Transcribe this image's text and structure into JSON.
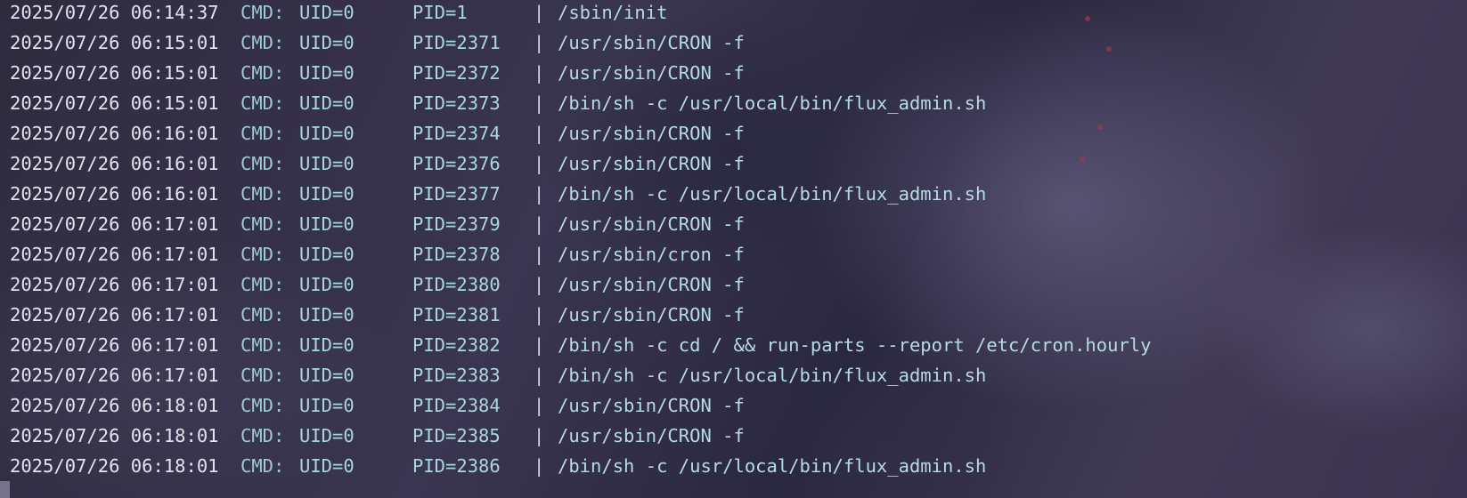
{
  "terminal": {
    "lines": [
      {
        "timestamp": "2025/07/26 06:14:37",
        "tag": "CMD:",
        "uid": "UID=0",
        "pid": "PID=1",
        "sep": "|",
        "command": "/sbin/init"
      },
      {
        "timestamp": "2025/07/26 06:15:01",
        "tag": "CMD:",
        "uid": "UID=0",
        "pid": "PID=2371",
        "sep": "|",
        "command": "/usr/sbin/CRON -f"
      },
      {
        "timestamp": "2025/07/26 06:15:01",
        "tag": "CMD:",
        "uid": "UID=0",
        "pid": "PID=2372",
        "sep": "|",
        "command": "/usr/sbin/CRON -f"
      },
      {
        "timestamp": "2025/07/26 06:15:01",
        "tag": "CMD:",
        "uid": "UID=0",
        "pid": "PID=2373",
        "sep": "|",
        "command": "/bin/sh -c /usr/local/bin/flux_admin.sh"
      },
      {
        "timestamp": "2025/07/26 06:16:01",
        "tag": "CMD:",
        "uid": "UID=0",
        "pid": "PID=2374",
        "sep": "|",
        "command": "/usr/sbin/CRON -f"
      },
      {
        "timestamp": "2025/07/26 06:16:01",
        "tag": "CMD:",
        "uid": "UID=0",
        "pid": "PID=2376",
        "sep": "|",
        "command": "/usr/sbin/CRON -f"
      },
      {
        "timestamp": "2025/07/26 06:16:01",
        "tag": "CMD:",
        "uid": "UID=0",
        "pid": "PID=2377",
        "sep": "|",
        "command": "/bin/sh -c /usr/local/bin/flux_admin.sh"
      },
      {
        "timestamp": "2025/07/26 06:17:01",
        "tag": "CMD:",
        "uid": "UID=0",
        "pid": "PID=2379",
        "sep": "|",
        "command": "/usr/sbin/CRON -f"
      },
      {
        "timestamp": "2025/07/26 06:17:01",
        "tag": "CMD:",
        "uid": "UID=0",
        "pid": "PID=2378",
        "sep": "|",
        "command": "/usr/sbin/cron -f"
      },
      {
        "timestamp": "2025/07/26 06:17:01",
        "tag": "CMD:",
        "uid": "UID=0",
        "pid": "PID=2380",
        "sep": "|",
        "command": "/usr/sbin/CRON -f"
      },
      {
        "timestamp": "2025/07/26 06:17:01",
        "tag": "CMD:",
        "uid": "UID=0",
        "pid": "PID=2381",
        "sep": "|",
        "command": "/usr/sbin/CRON -f"
      },
      {
        "timestamp": "2025/07/26 06:17:01",
        "tag": "CMD:",
        "uid": "UID=0",
        "pid": "PID=2382",
        "sep": "|",
        "command": "/bin/sh -c cd / && run-parts --report /etc/cron.hourly"
      },
      {
        "timestamp": "2025/07/26 06:17:01",
        "tag": "CMD:",
        "uid": "UID=0",
        "pid": "PID=2383",
        "sep": "|",
        "command": "/bin/sh -c /usr/local/bin/flux_admin.sh"
      },
      {
        "timestamp": "2025/07/26 06:18:01",
        "tag": "CMD:",
        "uid": "UID=0",
        "pid": "PID=2384",
        "sep": "|",
        "command": "/usr/sbin/CRON -f"
      },
      {
        "timestamp": "2025/07/26 06:18:01",
        "tag": "CMD:",
        "uid": "UID=0",
        "pid": "PID=2385",
        "sep": "|",
        "command": "/usr/sbin/CRON -f"
      },
      {
        "timestamp": "2025/07/26 06:18:01",
        "tag": "CMD:",
        "uid": "UID=0",
        "pid": "PID=2386",
        "sep": "|",
        "command": "/bin/sh -c /usr/local/bin/flux_admin.sh"
      }
    ]
  },
  "colors": {
    "timestamp": "#e4e2ee",
    "tag": "#9ec9d6",
    "fields": "#a9d6e0",
    "command": "#b6dbe6",
    "cursor": "#77738d",
    "background": "#2e2c3d"
  }
}
